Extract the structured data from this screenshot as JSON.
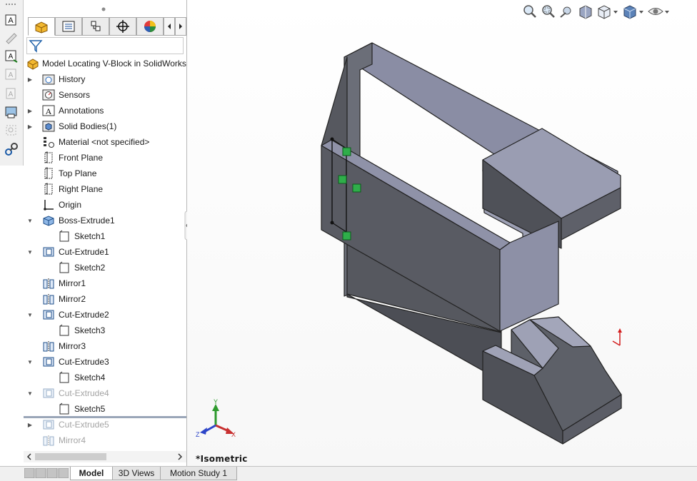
{
  "feature_tree": {
    "root": "Model Locating V-Block in SolidWorks",
    "items": [
      {
        "label": "History",
        "icon": "history-folder-icon",
        "expandable": true,
        "indent": 0,
        "dim": false
      },
      {
        "label": "Sensors",
        "icon": "sensors-icon",
        "expandable": false,
        "indent": 0,
        "dim": false
      },
      {
        "label": "Annotations",
        "icon": "annotations-icon",
        "expandable": true,
        "indent": 0,
        "dim": false
      },
      {
        "label": "Solid Bodies(1)",
        "icon": "solid-bodies-icon",
        "expandable": true,
        "indent": 0,
        "dim": false
      },
      {
        "label": "Material <not specified>",
        "icon": "material-icon",
        "expandable": false,
        "indent": 0,
        "dim": false
      },
      {
        "label": "Front Plane",
        "icon": "plane-icon",
        "expandable": false,
        "indent": 0,
        "dim": false
      },
      {
        "label": "Top Plane",
        "icon": "plane-icon",
        "expandable": false,
        "indent": 0,
        "dim": false
      },
      {
        "label": "Right Plane",
        "icon": "plane-icon",
        "expandable": false,
        "indent": 0,
        "dim": false
      },
      {
        "label": "Origin",
        "icon": "origin-icon",
        "expandable": false,
        "indent": 0,
        "dim": false
      },
      {
        "label": "Boss-Extrude1",
        "icon": "boss-extrude-icon",
        "expandable": true,
        "expanded": true,
        "indent": 0,
        "dim": false
      },
      {
        "label": "Sketch1",
        "icon": "sketch-icon",
        "expandable": false,
        "indent": 1,
        "dim": false
      },
      {
        "label": "Cut-Extrude1",
        "icon": "cut-extrude-icon",
        "expandable": true,
        "expanded": true,
        "indent": 0,
        "dim": false
      },
      {
        "label": "Sketch2",
        "icon": "sketch-icon",
        "expandable": false,
        "indent": 1,
        "dim": false
      },
      {
        "label": "Mirror1",
        "icon": "mirror-icon",
        "expandable": false,
        "indent": 0,
        "dim": false
      },
      {
        "label": "Mirror2",
        "icon": "mirror-icon",
        "expandable": false,
        "indent": 0,
        "dim": false
      },
      {
        "label": "Cut-Extrude2",
        "icon": "cut-extrude-icon",
        "expandable": true,
        "expanded": true,
        "indent": 0,
        "dim": false
      },
      {
        "label": "Sketch3",
        "icon": "sketch-icon",
        "expandable": false,
        "indent": 1,
        "dim": false
      },
      {
        "label": "Mirror3",
        "icon": "mirror-icon",
        "expandable": false,
        "indent": 0,
        "dim": false
      },
      {
        "label": "Cut-Extrude3",
        "icon": "cut-extrude-icon",
        "expandable": true,
        "expanded": true,
        "indent": 0,
        "dim": false
      },
      {
        "label": "Sketch4",
        "icon": "sketch-icon",
        "expandable": false,
        "indent": 1,
        "dim": false
      },
      {
        "label": "Cut-Extrude4",
        "icon": "cut-extrude-icon",
        "expandable": true,
        "expanded": true,
        "indent": 0,
        "dim": true
      },
      {
        "label": "Sketch5",
        "icon": "sketch-icon",
        "expandable": false,
        "indent": 1,
        "dim": false
      },
      {
        "label": "Cut-Extrude5",
        "icon": "cut-extrude-icon",
        "expandable": true,
        "indent": 0,
        "dim": true
      },
      {
        "label": "Mirror4",
        "icon": "mirror-icon",
        "expandable": false,
        "indent": 0,
        "dim": true
      }
    ]
  },
  "bottom_tabs": [
    "Model",
    "3D Views",
    "Motion Study 1"
  ],
  "active_bottom_tab": "Model",
  "viewport": {
    "view_label": "*Isometric",
    "triad": {
      "x": "X",
      "y": "Y",
      "z": "Z"
    }
  },
  "colors": {
    "part_face_dark": "#56585f",
    "part_face_mid": "#6b6e78",
    "part_face_light": "#9da0b4",
    "sketch_handle": "#2fae4a",
    "rollback_bar": "#9aa6b8"
  }
}
